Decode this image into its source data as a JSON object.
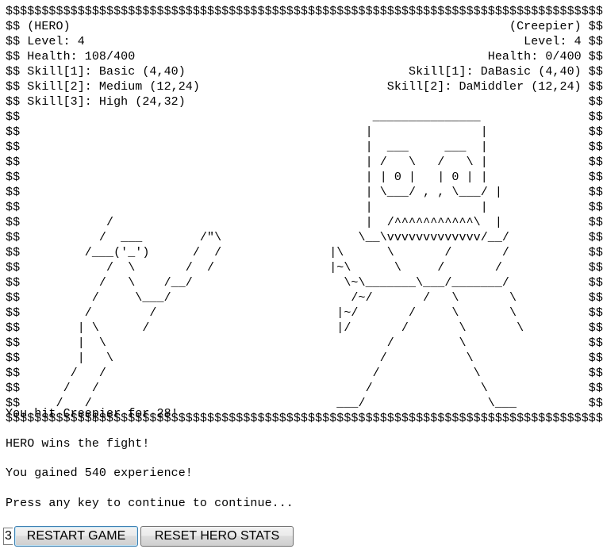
{
  "hero": {
    "name_line": "(HERO)",
    "level": "Level: 4",
    "health": "Health: 108/400",
    "skills": [
      "Skill[1]: Basic (4,40)",
      "Skill[2]: Medium (12,24)",
      "Skill[3]: High (24,32)"
    ]
  },
  "enemy": {
    "name_line": "(Creepier)",
    "level": "Level: 4",
    "health": "Health: 0/400",
    "skills": [
      "Skill[1]: DaBasic (4,40)",
      "Skill[2]: DaMiddler (12,24)"
    ]
  },
  "border_char": "$",
  "art_rows": [
    "                                                _______________",
    "                                               |               |",
    "                                               |  ___     ___  |",
    "                                               | /   \\   /   \\ |",
    "                                               | | 0 |   | 0 | |",
    "                                               | \\___/ , , \\___/ |",
    "                                               |               |",
    "           /                                   |  /^^^^^^^^^^^\\  |",
    "          /  ___        /\"\\                   \\__\\vvvvvvvvvvvvv/__/",
    "        /___('_')      /  /               |\\      \\       /       /",
    "           /  \\       /  /                |~\\      \\     /       /",
    "          /   \\    /__/                     \\~\\_______\\___/_______/",
    "         /     \\___/                         /~/       /   \\       \\",
    "        /        /                         |~/       /     \\       \\",
    "       | \\      /                          |/       /       \\       \\",
    "       |  \\                                       /         \\",
    "       |   \\                                     /           \\",
    "      /   /                                     /             \\",
    "     /   /                                     /               \\",
    "    /   /                                  ___/                 \\___"
  ],
  "messages": {
    "hit": "You hit Creepier for 28!",
    "win": "HERO wins the fight!",
    "xp": "You gained 540 experience!",
    "continue": "Press any key to continue to continue..."
  },
  "controls": {
    "key_input_value": "3",
    "restart_label": "RESTART GAME",
    "reset_label": "RESET HERO STATS"
  }
}
